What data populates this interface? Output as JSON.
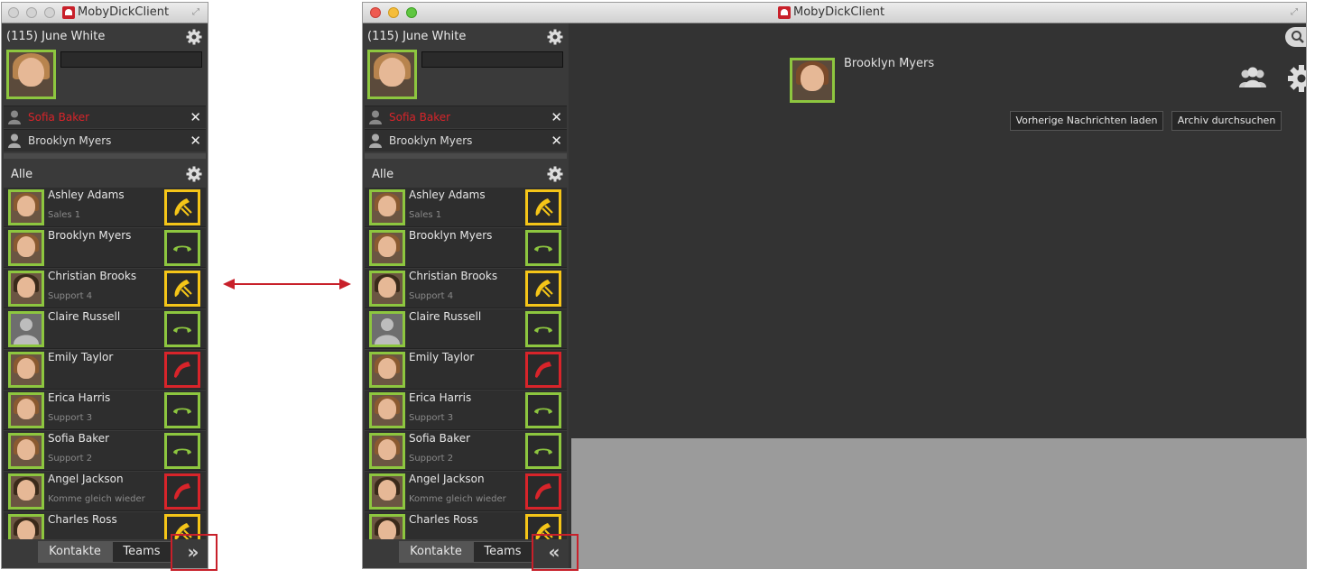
{
  "window": {
    "title": "MobyDickClient"
  },
  "profile": {
    "name": "(115) June White"
  },
  "open_chats": [
    {
      "name": "Sofia Baker",
      "unread": true
    },
    {
      "name": "Brooklyn Myers",
      "unread": false
    }
  ],
  "group": {
    "label": "Alle"
  },
  "contacts": [
    {
      "name": "Ashley Adams",
      "sub": "Sales 1",
      "status": "busy",
      "gender": "f"
    },
    {
      "name": "Brooklyn Myers",
      "sub": "",
      "status": "available",
      "gender": "f"
    },
    {
      "name": "Christian Brooks",
      "sub": "Support 4",
      "status": "busy",
      "gender": "m"
    },
    {
      "name": "Claire Russell",
      "sub": "",
      "status": "available",
      "gender": "none"
    },
    {
      "name": "Emily Taylor",
      "sub": "",
      "status": "offline",
      "gender": "f"
    },
    {
      "name": "Erica Harris",
      "sub": "Support 3",
      "status": "available",
      "gender": "f"
    },
    {
      "name": "Sofia Baker",
      "sub": "Support 2",
      "status": "available",
      "gender": "f"
    },
    {
      "name": "Angel Jackson",
      "sub": "Komme gleich wieder",
      "status": "offline",
      "gender": "m"
    },
    {
      "name": "Charles Ross",
      "sub": "",
      "status": "busy",
      "gender": "m"
    }
  ],
  "tabs": {
    "contacts": "Kontakte",
    "teams": "Teams"
  },
  "chat": {
    "partner": "Brooklyn Myers",
    "load_previous": "Vorherige Nachrichten laden",
    "search_archive": "Archiv durchsuchen"
  },
  "search": {
    "placeholder": "Suchen..."
  },
  "help": {
    "label": "?"
  },
  "colors": {
    "available": "#8dc63f",
    "busy": "#f5c518",
    "offline": "#d8242a",
    "highlight": "#c8202a"
  }
}
